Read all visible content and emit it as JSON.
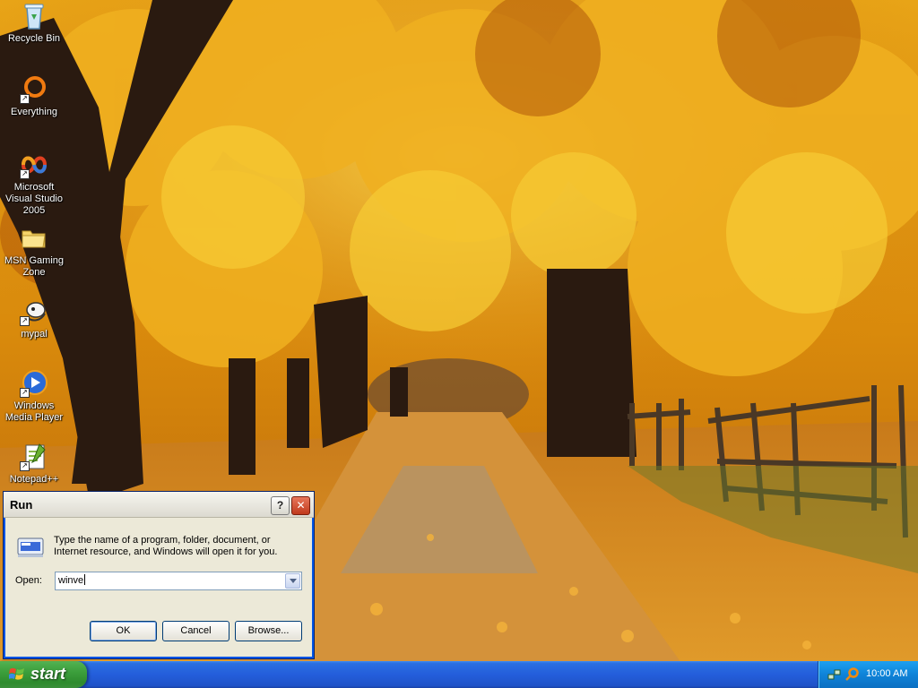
{
  "desktop": {
    "icons": [
      {
        "label": "Recycle Bin",
        "icon": "recycle-bin-icon"
      },
      {
        "label": "Everything",
        "icon": "everything-icon"
      },
      {
        "label": "Microsoft Visual Studio 2005",
        "icon": "visual-studio-icon"
      },
      {
        "label": "MSN Gaming Zone",
        "icon": "folder-icon"
      },
      {
        "label": "mypal",
        "icon": "mypal-icon"
      },
      {
        "label": "Windows Media Player",
        "icon": "media-player-icon"
      },
      {
        "label": "Notepad++",
        "icon": "notepad-plus-plus-icon"
      }
    ]
  },
  "run_dialog": {
    "title": "Run",
    "help_button": "?",
    "close_button": "✕",
    "description": "Type the name of a program, folder, document, or Internet resource, and Windows will open it for you.",
    "open_label": "Open:",
    "open_value": "winve",
    "ok_label": "OK",
    "cancel_label": "Cancel",
    "browse_label": "Browse..."
  },
  "taskbar": {
    "start_label": "start",
    "clock": "10:00 AM",
    "tray_icons": [
      "network-icon",
      "search-tray-icon"
    ]
  },
  "colors": {
    "taskbar_blue": "#245edb",
    "start_green": "#3c9f3c",
    "dialog_face": "#ece9d8"
  }
}
